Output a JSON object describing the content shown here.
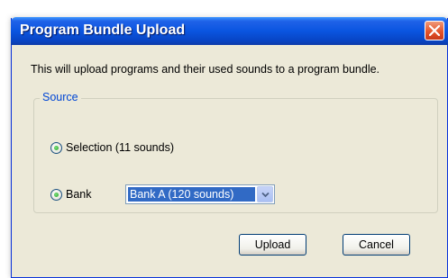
{
  "dialog": {
    "title": "Program Bundle Upload",
    "description": "This will upload programs and their used sounds to a program bundle."
  },
  "source": {
    "legend": "Source",
    "options": [
      {
        "label": "Selection (11 sounds)",
        "selected": true
      },
      {
        "label": "Bank",
        "selected": true
      }
    ],
    "bank_select": {
      "value": "Bank A (120 sounds)"
    }
  },
  "buttons": {
    "upload": "Upload",
    "cancel": "Cancel"
  },
  "icons": {
    "close": "close-icon",
    "dropdown": "chevron-down-icon"
  },
  "colors": {
    "title_bar": "#0a55e0",
    "dialog_bg": "#ece9d8",
    "legend_text": "#0046d5",
    "selection_highlight": "#316ac5",
    "close_button": "#e4542b"
  }
}
